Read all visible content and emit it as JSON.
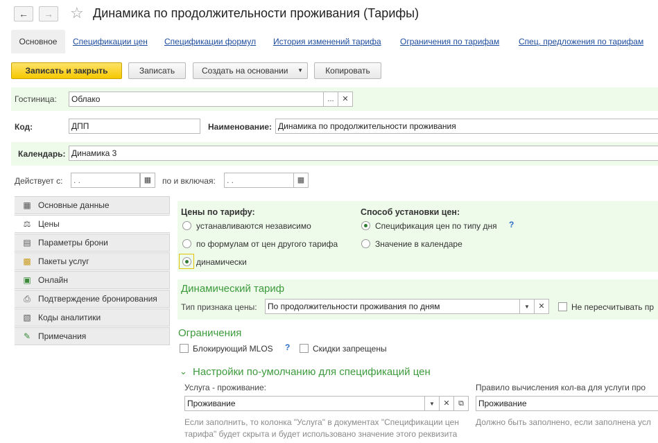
{
  "window": {
    "title": "Динамика по продолжительности проживания (Тарифы)"
  },
  "icons": {
    "back": "arrow-left-icon",
    "forward": "arrow-right-icon",
    "favorite": "star-icon"
  },
  "tabs": {
    "main": "Основное",
    "links": [
      "Спецификации цен",
      "Спецификации формул",
      "История изменений тарифа",
      "Ограничения по тарифам",
      "Спец. предложения по тарифам"
    ]
  },
  "toolbar": {
    "save_close": "Записать и закрыть",
    "save": "Записать",
    "create_based": "Создать на основании",
    "copy": "Копировать"
  },
  "form": {
    "hotel_label": "Гостиница:",
    "hotel_value": "Облако",
    "code_label": "Код:",
    "code_value": "ДПП",
    "name_label": "Наименование:",
    "name_value": "Динамика по продолжительности проживания",
    "calendar_label": "Календарь:",
    "calendar_value": "Динамика 3",
    "valid_from_label": "Действует с:",
    "valid_from_value": " .  .",
    "valid_to_label": "по и включая:",
    "valid_to_value": " .  ."
  },
  "sidebar": {
    "items": [
      {
        "label": "Основные данные",
        "icon": "table-icon"
      },
      {
        "label": "Цены",
        "icon": "scale-icon"
      },
      {
        "label": "Параметры брони",
        "icon": "document-icon"
      },
      {
        "label": "Пакеты услуг",
        "icon": "package-icon"
      },
      {
        "label": "Онлайн",
        "icon": "online-icon"
      },
      {
        "label": "Подтверждение бронирования",
        "icon": "printer-icon"
      },
      {
        "label": "Коды аналитики",
        "icon": "chart-icon"
      },
      {
        "label": "Примечания",
        "icon": "pencil-icon"
      }
    ]
  },
  "prices": {
    "heading": "Цены по тарифу:",
    "options": [
      "устанавливаются независимо",
      "по формулам от цен другого тарифа",
      "динамически"
    ],
    "method_heading": "Способ установки цен:",
    "method_options": [
      "Спецификация цен по типу дня",
      "Значение в календаре"
    ],
    "help": "?"
  },
  "dynamic": {
    "heading": "Динамический тариф",
    "price_type_label": "Тип признака цены:",
    "price_type_value": "По продолжительности проживания по дням",
    "no_recalc_label": "Не пересчитывать пр"
  },
  "restrictions": {
    "heading": "Ограничения",
    "block_mlos": "Блокирующий MLOS",
    "discounts_forbidden": "Скидки запрещены",
    "help": "?"
  },
  "defaults": {
    "heading": "Настройки по-умолчанию для спецификаций цен",
    "service_label": "Услуга - проживание:",
    "service_value": "Проживание",
    "rule_label": "Правило вычисления кол-ва для услуги про",
    "rule_value": "Проживание",
    "service_hint": "Если заполнить, то колонка \"Услуга\" в документах \"Спецификации цен тарифа\" будет скрыта и будет использовано значение этого реквизита",
    "rule_hint": "Должно быть заполнено, если заполнена усл"
  }
}
